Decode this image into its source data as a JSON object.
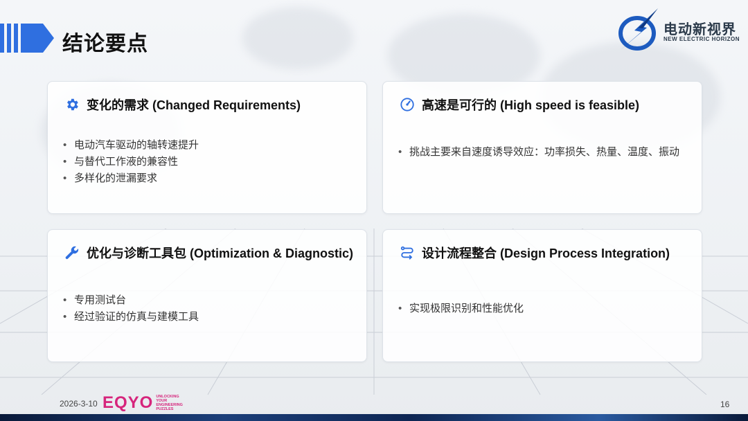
{
  "header": {
    "title": "结论要点",
    "logo": {
      "name": "电动新视界",
      "tagline": "NEW ELECTRIC HORIZON"
    }
  },
  "cards": [
    {
      "icon": "gear-icon",
      "title": "变化的需求 (Changed Requirements)",
      "bullets": [
        "电动汽车驱动的轴转速提升",
        "与替代工作液的兼容性",
        "多样化的泄漏要求"
      ]
    },
    {
      "icon": "speedometer-icon",
      "title": "高速是可行的 (High speed is feasible)",
      "bullets": [
        "挑战主要来自速度诱导效应：功率损失、热量、温度、振动"
      ]
    },
    {
      "icon": "wrench-icon",
      "title": "优化与诊断工具包 (Optimization & Diagnostic)",
      "bullets": [
        "专用测试台",
        "经过验证的仿真与建模工具"
      ]
    },
    {
      "icon": "process-flow-icon",
      "title": "设计流程整合 (Design Process Integration)",
      "bullets": [
        "实现极限识别和性能优化"
      ]
    }
  ],
  "footer": {
    "date": "2026-3-10",
    "brand": "EQYO",
    "brand_tagline": [
      "UNLOCKING",
      "YOUR",
      "ENGINEERING",
      "PUZZLES"
    ],
    "page_number": "16"
  },
  "colors": {
    "accent": "#2f6fe0",
    "brand": "#d6257c",
    "title": "#111111"
  }
}
